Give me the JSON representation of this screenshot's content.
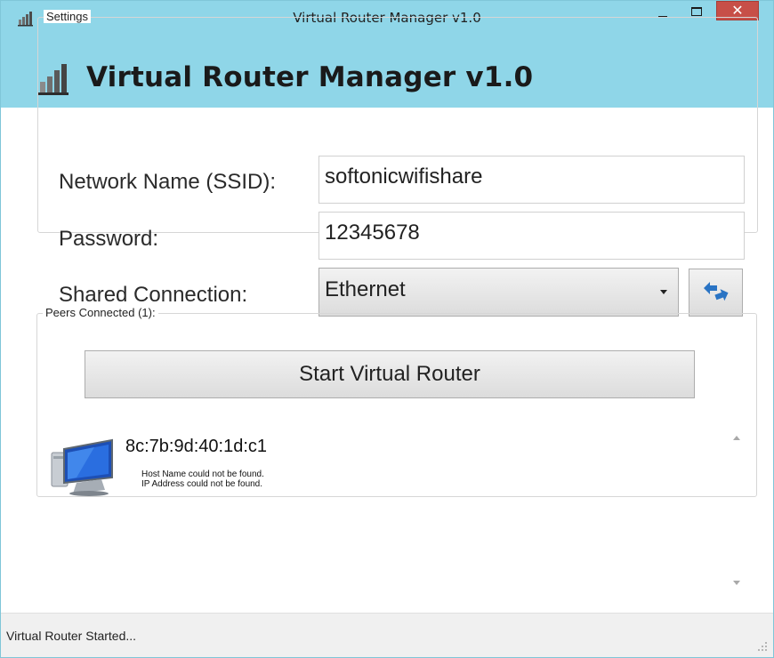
{
  "window": {
    "title": "Virtual Router Manager v1.0",
    "close_glyph": "✕"
  },
  "header": {
    "title": "Virtual Router Manager v1.0"
  },
  "settings": {
    "legend": "Settings",
    "ssid_label": "Network Name (SSID):",
    "ssid_value": "softonicwifishare",
    "password_label": "Password:",
    "password_value": "12345678",
    "shared_label": "Shared Connection:",
    "shared_value": "Ethernet"
  },
  "start_button": "Start Virtual Router",
  "peers": {
    "legend": "Peers Connected (1):",
    "items": [
      {
        "mac": "8c:7b:9d:40:1d:c1",
        "host": "Host Name could not be found.",
        "ip": "IP Address could not be found."
      }
    ]
  },
  "status": {
    "text": "Virtual Router Started..."
  },
  "icons": {
    "app": "router-signal-icon",
    "refresh": "refresh-arrows-icon",
    "computer": "computer-monitor-icon"
  },
  "colors": {
    "titlebar": "#8fd6e8",
    "close": "#c74f48",
    "refresh_blue": "#2a74c4"
  }
}
